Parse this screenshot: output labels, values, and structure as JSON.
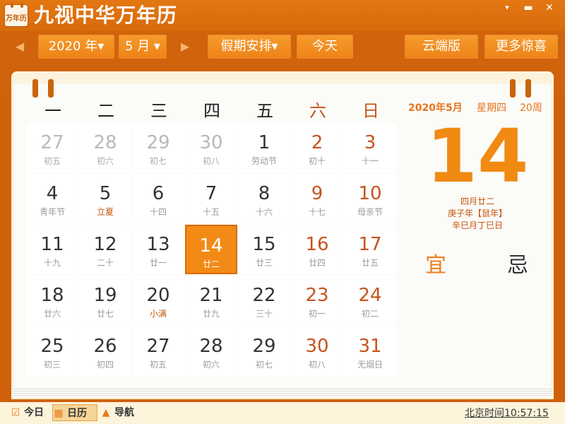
{
  "app": {
    "icon_text": "万年历",
    "title": "九视中华万年历",
    "menu_glyph": "▾",
    "min_glyph": "▬",
    "close_glyph": "✕"
  },
  "toolbar": {
    "prev_glyph": "◀",
    "next_glyph": "▶",
    "year_value": "2020 年▾",
    "month_value": "5 月 ▾",
    "holiday_label": "假期安排▾",
    "today_label": "今天",
    "cloud_label": "云端版",
    "more_label": "更多惊喜"
  },
  "weekdays": [
    "一",
    "二",
    "三",
    "四",
    "五",
    "六",
    "日"
  ],
  "days": [
    {
      "n": "27",
      "l": "初五",
      "t": "other"
    },
    {
      "n": "28",
      "l": "初六",
      "t": "other"
    },
    {
      "n": "29",
      "l": "初七",
      "t": "other"
    },
    {
      "n": "30",
      "l": "初八",
      "t": "other"
    },
    {
      "n": "1",
      "l": "劳动节",
      "t": ""
    },
    {
      "n": "2",
      "l": "初十",
      "t": "weekend"
    },
    {
      "n": "3",
      "l": "十一",
      "t": "weekend"
    },
    {
      "n": "4",
      "l": "青年节",
      "t": ""
    },
    {
      "n": "5",
      "l": "立夏",
      "t": "solar-term"
    },
    {
      "n": "6",
      "l": "十四",
      "t": ""
    },
    {
      "n": "7",
      "l": "十五",
      "t": ""
    },
    {
      "n": "8",
      "l": "十六",
      "t": ""
    },
    {
      "n": "9",
      "l": "十七",
      "t": "weekend"
    },
    {
      "n": "10",
      "l": "母亲节",
      "t": "weekend"
    },
    {
      "n": "11",
      "l": "十九",
      "t": ""
    },
    {
      "n": "12",
      "l": "二十",
      "t": ""
    },
    {
      "n": "13",
      "l": "廿一",
      "t": ""
    },
    {
      "n": "14",
      "l": "廿二",
      "t": "today"
    },
    {
      "n": "15",
      "l": "廿三",
      "t": ""
    },
    {
      "n": "16",
      "l": "廿四",
      "t": "weekend"
    },
    {
      "n": "17",
      "l": "廿五",
      "t": "weekend"
    },
    {
      "n": "18",
      "l": "廿六",
      "t": ""
    },
    {
      "n": "19",
      "l": "廿七",
      "t": ""
    },
    {
      "n": "20",
      "l": "小满",
      "t": "solar-term"
    },
    {
      "n": "21",
      "l": "廿九",
      "t": ""
    },
    {
      "n": "22",
      "l": "三十",
      "t": ""
    },
    {
      "n": "23",
      "l": "初一",
      "t": "weekend"
    },
    {
      "n": "24",
      "l": "初二",
      "t": "weekend"
    },
    {
      "n": "25",
      "l": "初三",
      "t": ""
    },
    {
      "n": "26",
      "l": "初四",
      "t": ""
    },
    {
      "n": "27",
      "l": "初五",
      "t": ""
    },
    {
      "n": "28",
      "l": "初六",
      "t": ""
    },
    {
      "n": "29",
      "l": "初七",
      "t": ""
    },
    {
      "n": "30",
      "l": "初八",
      "t": "weekend"
    },
    {
      "n": "31",
      "l": "无烟日",
      "t": "weekend"
    }
  ],
  "detail": {
    "year_month": "2020年5月",
    "weekday": "星期四",
    "week": "20周",
    "day": "14",
    "lunar_date": "四月廿二",
    "ganzhi_year": "庚子年【鼠年】",
    "ganzhi_month_day": "辛巳月丁巳日",
    "yi": "宜",
    "ji": "忌"
  },
  "status": {
    "today_label": "今日",
    "calendar_label": "日历",
    "nav_label": "导航",
    "clock": "北京时间10:57:15"
  },
  "colors": {
    "accent": "#f08a11",
    "header": "#d86a0b",
    "weekend": "#c5541c"
  }
}
